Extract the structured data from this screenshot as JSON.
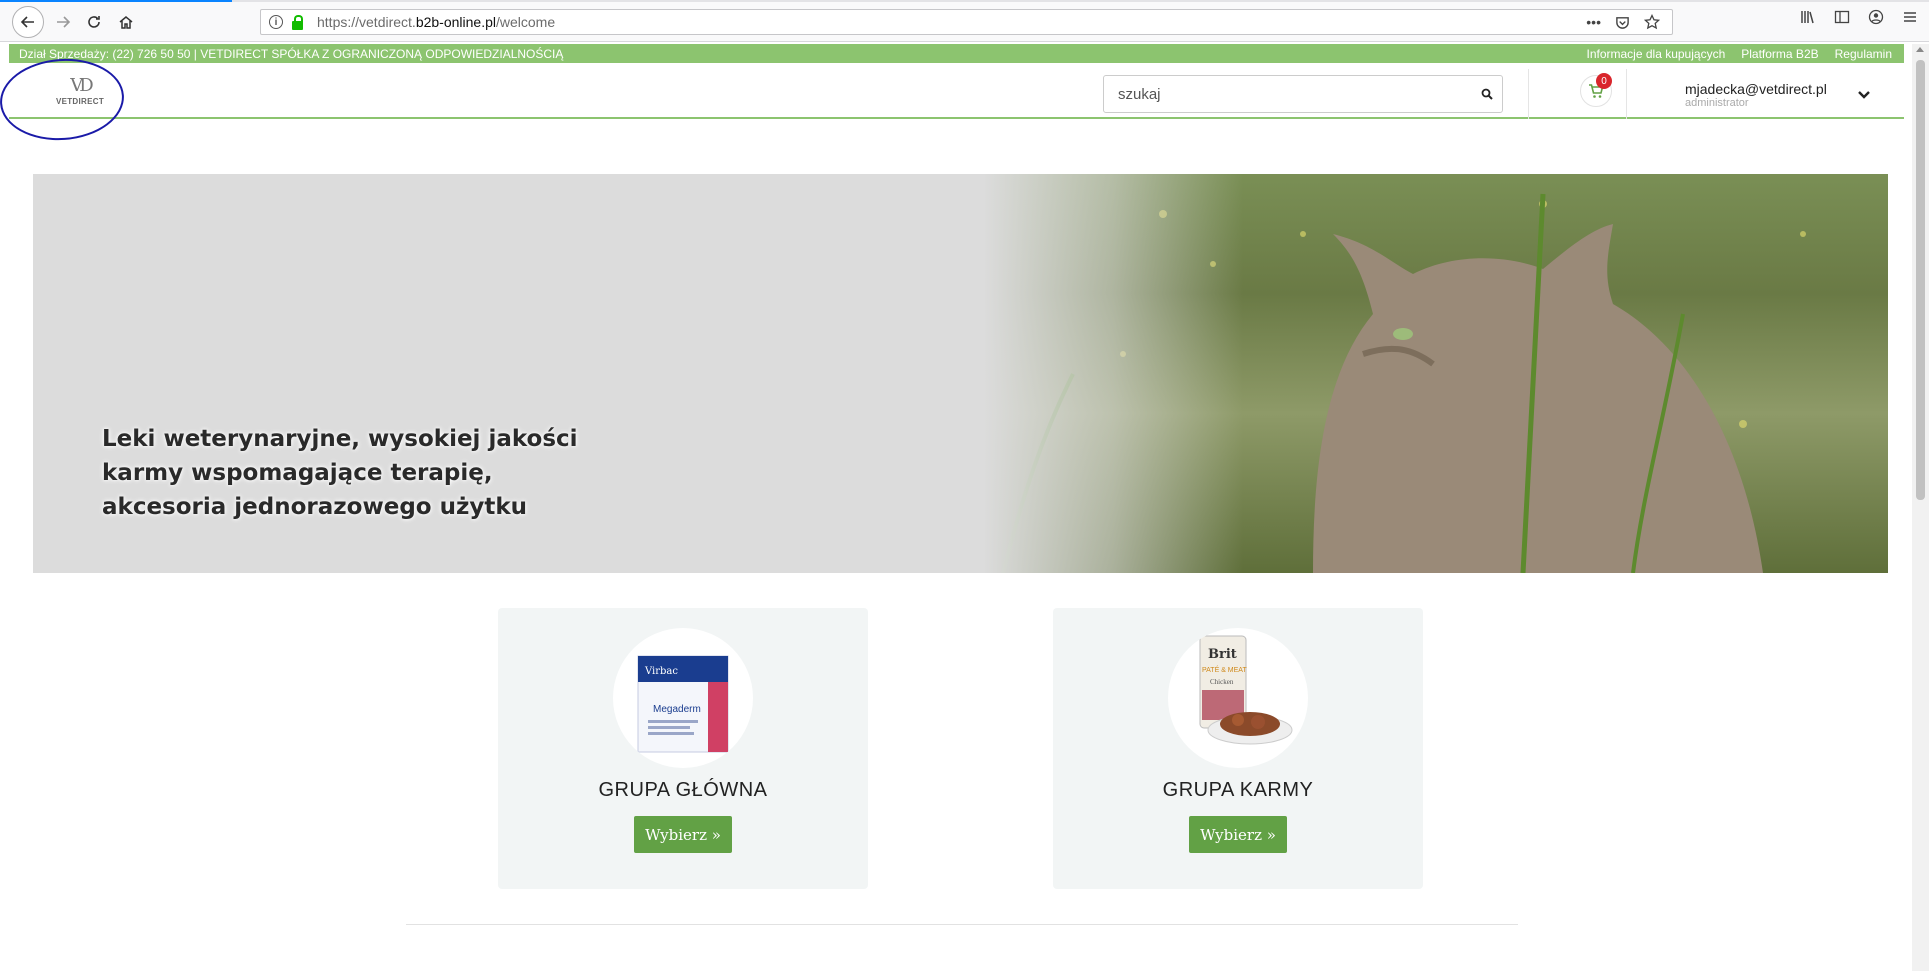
{
  "browser": {
    "url_prefix": "https://vetdirect.",
    "url_domain": "b2b-online.pl",
    "url_path": "/welcome",
    "more_actions": "•••"
  },
  "topbar": {
    "contact": "Dział Sprzedaży: (22) 726 50 50 | VETDIRECT SPÓŁKA Z OGRANICZONĄ ODPOWIEDZIALNOŚCIĄ",
    "links": [
      "Informacje dla kupujących",
      "Platforma B2B",
      "Regulamin"
    ]
  },
  "header": {
    "logo_mark": "VD",
    "logo_text": "VETDIRECT",
    "search_placeholder": "szukaj",
    "cart_count": "0",
    "user_email": "mjadecka@vetdirect.pl",
    "user_role": "administrator"
  },
  "hero": {
    "line1": "Leki weterynaryjne, wysokiej jakości",
    "line2": "karmy wspomagające terapię,",
    "line3": "akcesoria jednorazowego użytku"
  },
  "cards": [
    {
      "title": "GRUPA GŁÓWNA",
      "button": "Wybierz »",
      "product_brand": "Virbac",
      "product_name": "Megaderm"
    },
    {
      "title": "GRUPA KARMY",
      "button": "Wybierz »",
      "product_brand": "Brit",
      "product_line": "PATÉ & MEAT",
      "product_flavor": "Chicken"
    }
  ],
  "colors": {
    "accent_green": "#8cc46f",
    "button_green": "#62a145",
    "badge_red": "#d9262c",
    "annotation_blue": "#1a1aa8"
  }
}
